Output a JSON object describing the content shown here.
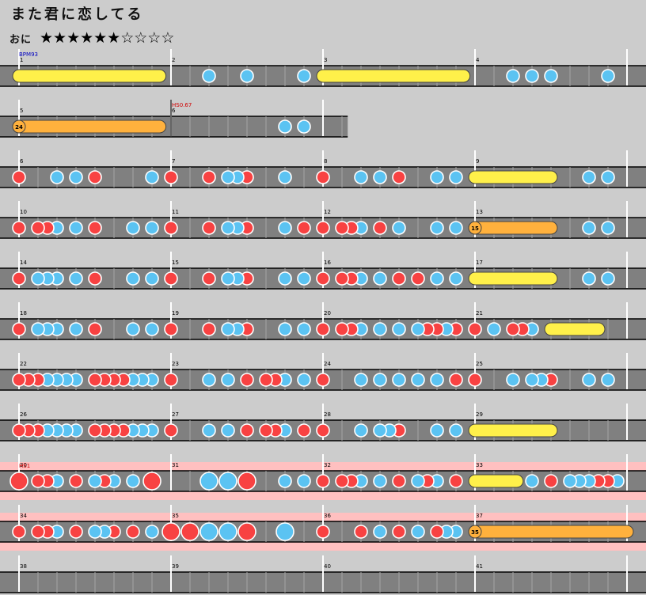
{
  "song": {
    "title": "また君に恋してる"
  },
  "difficulty": {
    "label": "おに",
    "stars": "★★★★★★☆☆☆☆",
    "level": 6,
    "max_level": 10
  },
  "colors": {
    "background": "#cccccc",
    "lane": "#808080",
    "don": "#f84242",
    "ka": "#5bc3f2",
    "roll": "#fff04a",
    "balloon": "#ffb13d",
    "bpm_text": "#0000c0",
    "hs_text": "#d00000",
    "hs_band": "#ffc0c0"
  },
  "chart_data": {
    "type": "table",
    "units": "beats",
    "beats_per_measure": 4,
    "bpm": {
      "label": "BPM93",
      "value": 93,
      "at_measure": 1
    },
    "scroll_changes": [
      {
        "label": "HS0.67",
        "measure": 2
      },
      {
        "label": "HS1",
        "row": 9
      }
    ],
    "rows": [
      {
        "start": 1,
        "measures": [
          "1",
          "2",
          "3",
          "4"
        ],
        "hs_band": false,
        "notes": [
          {
            "t": "roll",
            "b": 0,
            "e": 3.7
          },
          {
            "t": "k",
            "b": 5
          },
          {
            "t": "k",
            "b": 6
          },
          {
            "t": "k",
            "b": 7.5
          },
          {
            "t": "roll",
            "b": 8,
            "e": 11.7
          },
          {
            "t": "k",
            "b": 13
          },
          {
            "t": "k",
            "b": 13.5
          },
          {
            "t": "k",
            "b": 14
          },
          {
            "t": "k",
            "b": 15.5
          }
        ]
      },
      {
        "start": 5,
        "measures": [
          "5",
          "6"
        ],
        "hs_band": false,
        "partial_beats": 8.65,
        "notes": [
          {
            "t": "balloon",
            "b": 0,
            "e": 3.7,
            "count": "24"
          },
          {
            "t": "k",
            "b": 7
          },
          {
            "t": "k",
            "b": 7.5
          }
        ]
      },
      {
        "start": 6,
        "measures": [
          "6",
          "7",
          "8",
          "9"
        ],
        "hs_band": false,
        "notes": [
          {
            "t": "d",
            "b": 0
          },
          {
            "t": "k",
            "b": 1
          },
          {
            "t": "k",
            "b": 1.5
          },
          {
            "t": "d",
            "b": 2
          },
          {
            "t": "k",
            "b": 3.5
          },
          {
            "t": "d",
            "b": 4
          },
          {
            "t": "d",
            "b": 5
          },
          {
            "t": "k",
            "b": 5.5
          },
          {
            "t": "k",
            "b": 5.75
          },
          {
            "t": "d",
            "b": 6
          },
          {
            "t": "k",
            "b": 7
          },
          {
            "t": "d",
            "b": 8
          },
          {
            "t": "k",
            "b": 9
          },
          {
            "t": "k",
            "b": 9.5
          },
          {
            "t": "d",
            "b": 10
          },
          {
            "t": "k",
            "b": 11
          },
          {
            "t": "k",
            "b": 11.5
          },
          {
            "t": "roll",
            "b": 12,
            "e": 14
          },
          {
            "t": "k",
            "b": 15
          },
          {
            "t": "k",
            "b": 15.5
          }
        ]
      },
      {
        "start": 10,
        "measures": [
          "10",
          "11",
          "12",
          "13"
        ],
        "hs_band": false,
        "notes": [
          {
            "t": "d",
            "b": 0
          },
          {
            "t": "d",
            "b": 0.5
          },
          {
            "t": "d",
            "b": 0.75
          },
          {
            "t": "k",
            "b": 1
          },
          {
            "t": "k",
            "b": 1.5
          },
          {
            "t": "d",
            "b": 2
          },
          {
            "t": "k",
            "b": 3
          },
          {
            "t": "k",
            "b": 3.5
          },
          {
            "t": "d",
            "b": 4
          },
          {
            "t": "d",
            "b": 5
          },
          {
            "t": "k",
            "b": 5.5
          },
          {
            "t": "k",
            "b": 5.75
          },
          {
            "t": "d",
            "b": 6
          },
          {
            "t": "k",
            "b": 7
          },
          {
            "t": "d",
            "b": 7.5
          },
          {
            "t": "d",
            "b": 8
          },
          {
            "t": "d",
            "b": 8.5
          },
          {
            "t": "d",
            "b": 8.75
          },
          {
            "t": "k",
            "b": 9
          },
          {
            "t": "d",
            "b": 9.5
          },
          {
            "t": "k",
            "b": 10
          },
          {
            "t": "k",
            "b": 11
          },
          {
            "t": "k",
            "b": 11.5
          },
          {
            "t": "balloon",
            "b": 12,
            "e": 14,
            "count": "15"
          },
          {
            "t": "k",
            "b": 15
          },
          {
            "t": "k",
            "b": 15.5
          }
        ]
      },
      {
        "start": 14,
        "measures": [
          "14",
          "15",
          "16",
          "17"
        ],
        "hs_band": false,
        "notes": [
          {
            "t": "d",
            "b": 0
          },
          {
            "t": "k",
            "b": 0.5
          },
          {
            "t": "k",
            "b": 0.75
          },
          {
            "t": "k",
            "b": 1
          },
          {
            "t": "k",
            "b": 1.5
          },
          {
            "t": "d",
            "b": 2
          },
          {
            "t": "k",
            "b": 3
          },
          {
            "t": "k",
            "b": 3.5
          },
          {
            "t": "d",
            "b": 4
          },
          {
            "t": "d",
            "b": 5
          },
          {
            "t": "k",
            "b": 5.5
          },
          {
            "t": "k",
            "b": 5.75
          },
          {
            "t": "d",
            "b": 6
          },
          {
            "t": "k",
            "b": 7
          },
          {
            "t": "k",
            "b": 7.5
          },
          {
            "t": "d",
            "b": 8
          },
          {
            "t": "d",
            "b": 8.5
          },
          {
            "t": "d",
            "b": 8.75
          },
          {
            "t": "k",
            "b": 9
          },
          {
            "t": "k",
            "b": 9.5
          },
          {
            "t": "d",
            "b": 10
          },
          {
            "t": "d",
            "b": 10.5
          },
          {
            "t": "k",
            "b": 11
          },
          {
            "t": "k",
            "b": 11.5
          },
          {
            "t": "roll",
            "b": 12,
            "e": 14
          },
          {
            "t": "k",
            "b": 15
          },
          {
            "t": "k",
            "b": 15.5
          }
        ]
      },
      {
        "start": 18,
        "measures": [
          "18",
          "19",
          "20",
          "21"
        ],
        "hs_band": false,
        "notes": [
          {
            "t": "d",
            "b": 0
          },
          {
            "t": "k",
            "b": 0.5
          },
          {
            "t": "k",
            "b": 0.75
          },
          {
            "t": "k",
            "b": 1
          },
          {
            "t": "k",
            "b": 1.5
          },
          {
            "t": "d",
            "b": 2
          },
          {
            "t": "k",
            "b": 3
          },
          {
            "t": "k",
            "b": 3.5
          },
          {
            "t": "d",
            "b": 4
          },
          {
            "t": "d",
            "b": 5
          },
          {
            "t": "k",
            "b": 5.5
          },
          {
            "t": "k",
            "b": 5.75
          },
          {
            "t": "d",
            "b": 6
          },
          {
            "t": "k",
            "b": 7
          },
          {
            "t": "k",
            "b": 7.5
          },
          {
            "t": "d",
            "b": 8
          },
          {
            "t": "d",
            "b": 8.5
          },
          {
            "t": "d",
            "b": 8.75
          },
          {
            "t": "k",
            "b": 9
          },
          {
            "t": "k",
            "b": 9.5
          },
          {
            "t": "k",
            "b": 10
          },
          {
            "t": "k",
            "b": 10.5
          },
          {
            "t": "d",
            "b": 10.75
          },
          {
            "t": "d",
            "b": 11
          },
          {
            "t": "k",
            "b": 11.25
          },
          {
            "t": "d",
            "b": 11.5
          },
          {
            "t": "d",
            "b": 12
          },
          {
            "t": "k",
            "b": 12.5
          },
          {
            "t": "d",
            "b": 13
          },
          {
            "t": "d",
            "b": 13.25
          },
          {
            "t": "k",
            "b": 13.5
          },
          {
            "t": "roll",
            "b": 14,
            "e": 15.25
          }
        ]
      },
      {
        "start": 22,
        "measures": [
          "22",
          "23",
          "24",
          "25"
        ],
        "hs_band": false,
        "notes": [
          {
            "t": "d",
            "b": 0
          },
          {
            "t": "d",
            "b": 0.25
          },
          {
            "t": "d",
            "b": 0.5
          },
          {
            "t": "k",
            "b": 0.75
          },
          {
            "t": "k",
            "b": 1
          },
          {
            "t": "k",
            "b": 1.25
          },
          {
            "t": "k",
            "b": 1.5
          },
          {
            "t": "d",
            "b": 2
          },
          {
            "t": "d",
            "b": 2.25
          },
          {
            "t": "d",
            "b": 2.5
          },
          {
            "t": "d",
            "b": 2.75
          },
          {
            "t": "k",
            "b": 3
          },
          {
            "t": "k",
            "b": 3.25
          },
          {
            "t": "k",
            "b": 3.5
          },
          {
            "t": "d",
            "b": 4
          },
          {
            "t": "k",
            "b": 5
          },
          {
            "t": "k",
            "b": 5.5
          },
          {
            "t": "d",
            "b": 6
          },
          {
            "t": "d",
            "b": 6.5
          },
          {
            "t": "d",
            "b": 6.75
          },
          {
            "t": "k",
            "b": 7
          },
          {
            "t": "k",
            "b": 7.5
          },
          {
            "t": "d",
            "b": 8
          },
          {
            "t": "k",
            "b": 9
          },
          {
            "t": "k",
            "b": 9.5
          },
          {
            "t": "k",
            "b": 10
          },
          {
            "t": "k",
            "b": 10.5
          },
          {
            "t": "k",
            "b": 11
          },
          {
            "t": "d",
            "b": 11.5
          },
          {
            "t": "d",
            "b": 12
          },
          {
            "t": "k",
            "b": 13
          },
          {
            "t": "k",
            "b": 13.5
          },
          {
            "t": "k",
            "b": 13.75
          },
          {
            "t": "d",
            "b": 14
          },
          {
            "t": "k",
            "b": 15
          },
          {
            "t": "k",
            "b": 15.5
          }
        ]
      },
      {
        "start": 26,
        "measures": [
          "26",
          "27",
          "28",
          "29"
        ],
        "hs_band": false,
        "notes": [
          {
            "t": "d",
            "b": 0
          },
          {
            "t": "d",
            "b": 0.25
          },
          {
            "t": "d",
            "b": 0.5
          },
          {
            "t": "k",
            "b": 0.75
          },
          {
            "t": "k",
            "b": 1
          },
          {
            "t": "k",
            "b": 1.25
          },
          {
            "t": "k",
            "b": 1.5
          },
          {
            "t": "d",
            "b": 2
          },
          {
            "t": "d",
            "b": 2.25
          },
          {
            "t": "d",
            "b": 2.5
          },
          {
            "t": "d",
            "b": 2.75
          },
          {
            "t": "k",
            "b": 3
          },
          {
            "t": "k",
            "b": 3.25
          },
          {
            "t": "k",
            "b": 3.5
          },
          {
            "t": "d",
            "b": 4
          },
          {
            "t": "k",
            "b": 5
          },
          {
            "t": "k",
            "b": 5.5
          },
          {
            "t": "d",
            "b": 6
          },
          {
            "t": "d",
            "b": 6.5
          },
          {
            "t": "d",
            "b": 6.75
          },
          {
            "t": "k",
            "b": 7
          },
          {
            "t": "d",
            "b": 7.5
          },
          {
            "t": "d",
            "b": 8
          },
          {
            "t": "k",
            "b": 9
          },
          {
            "t": "k",
            "b": 9.5
          },
          {
            "t": "k",
            "b": 9.75
          },
          {
            "t": "d",
            "b": 10
          },
          {
            "t": "k",
            "b": 11
          },
          {
            "t": "k",
            "b": 11.5
          },
          {
            "t": "roll",
            "b": 12,
            "e": 14
          }
        ]
      },
      {
        "start": 30,
        "measures": [
          "30",
          "31",
          "32",
          "33"
        ],
        "hs_band": true,
        "notes": [
          {
            "t": "D",
            "b": 0
          },
          {
            "t": "d",
            "b": 0.5
          },
          {
            "t": "d",
            "b": 0.75
          },
          {
            "t": "k",
            "b": 1
          },
          {
            "t": "d",
            "b": 1.5
          },
          {
            "t": "k",
            "b": 2
          },
          {
            "t": "d",
            "b": 2.25
          },
          {
            "t": "k",
            "b": 2.5
          },
          {
            "t": "k",
            "b": 3
          },
          {
            "t": "D",
            "b": 3.5
          },
          {
            "t": "K",
            "b": 5
          },
          {
            "t": "K",
            "b": 5.5
          },
          {
            "t": "D",
            "b": 6
          },
          {
            "t": "k",
            "b": 7
          },
          {
            "t": "k",
            "b": 7.5
          },
          {
            "t": "d",
            "b": 8
          },
          {
            "t": "d",
            "b": 8.5
          },
          {
            "t": "d",
            "b": 8.75
          },
          {
            "t": "k",
            "b": 9
          },
          {
            "t": "k",
            "b": 9.5
          },
          {
            "t": "d",
            "b": 10
          },
          {
            "t": "k",
            "b": 10.5
          },
          {
            "t": "d",
            "b": 10.75
          },
          {
            "t": "k",
            "b": 11
          },
          {
            "t": "d",
            "b": 11.5
          },
          {
            "t": "roll",
            "b": 12,
            "e": 13.1
          },
          {
            "t": "k",
            "b": 13.5
          },
          {
            "t": "d",
            "b": 14
          },
          {
            "t": "k",
            "b": 14.5
          },
          {
            "t": "k",
            "b": 14.75
          },
          {
            "t": "k",
            "b": 15
          },
          {
            "t": "d",
            "b": 15.25
          },
          {
            "t": "d",
            "b": 15.5
          },
          {
            "t": "k",
            "b": 15.75
          }
        ]
      },
      {
        "start": 34,
        "measures": [
          "34",
          "35",
          "36",
          "37"
        ],
        "hs_band": true,
        "notes": [
          {
            "t": "d",
            "b": 0
          },
          {
            "t": "d",
            "b": 0.5
          },
          {
            "t": "d",
            "b": 0.75
          },
          {
            "t": "k",
            "b": 1
          },
          {
            "t": "d",
            "b": 1.5
          },
          {
            "t": "k",
            "b": 2
          },
          {
            "t": "k",
            "b": 2.25
          },
          {
            "t": "d",
            "b": 2.5
          },
          {
            "t": "d",
            "b": 3
          },
          {
            "t": "k",
            "b": 3.5
          },
          {
            "t": "D",
            "b": 4
          },
          {
            "t": "D",
            "b": 4.5
          },
          {
            "t": "K",
            "b": 5
          },
          {
            "t": "K",
            "b": 5.5
          },
          {
            "t": "D",
            "b": 6
          },
          {
            "t": "K",
            "b": 7
          },
          {
            "t": "d",
            "b": 8
          },
          {
            "t": "d",
            "b": 9
          },
          {
            "t": "k",
            "b": 9.5
          },
          {
            "t": "d",
            "b": 10
          },
          {
            "t": "k",
            "b": 10.5
          },
          {
            "t": "d",
            "b": 11
          },
          {
            "t": "k",
            "b": 11.25
          },
          {
            "t": "k",
            "b": 11.5
          },
          {
            "t": "balloon",
            "b": 12,
            "e": 16,
            "count": "35"
          }
        ]
      },
      {
        "start": 38,
        "measures": [
          "38",
          "39",
          "40",
          "41"
        ],
        "hs_band": false,
        "notes": []
      }
    ]
  }
}
